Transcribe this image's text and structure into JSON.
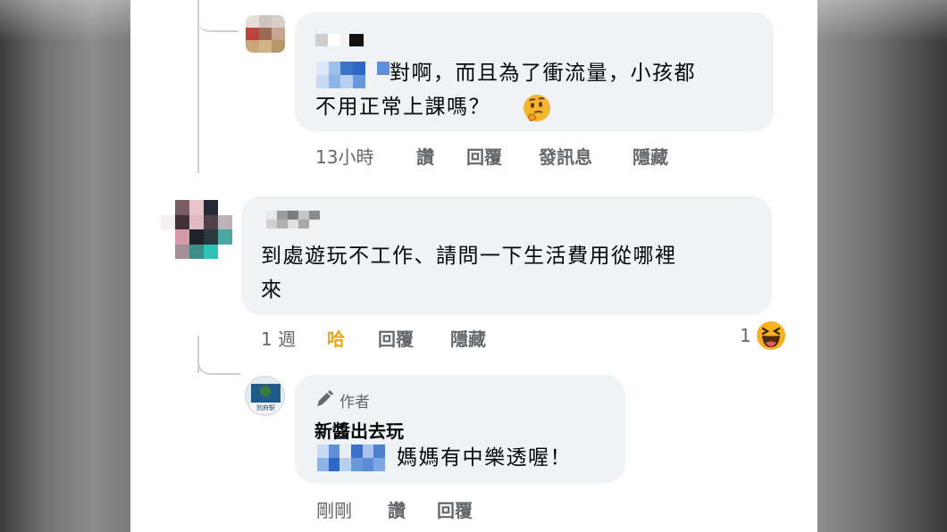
{
  "comments": [
    {
      "text_line1": "對啊，而且為了衝流量，小孩都",
      "text_line2": "不用正常上課嗎？",
      "time": "13小時",
      "like_label": "讚",
      "reply_label": "回覆",
      "message_label": "發訊息",
      "hide_label": "隱藏",
      "emoji": "thinking-face-emoji"
    },
    {
      "text_line1": "到處遊玩不工作、請問一下生活費用從哪裡",
      "text_line2": "來",
      "time": "1 週",
      "reaction_label": "哈",
      "reply_label": "回覆",
      "hide_label": "隱藏",
      "reaction_count": "1",
      "reaction_icon": "haha-reaction-icon"
    },
    {
      "author_badge": "作者",
      "author_name": "新醬出去玩",
      "text": "媽媽有中樂透喔！",
      "time": "剛剛",
      "like_label": "讚",
      "reply_label": "回覆",
      "avatar_text": "別府駅"
    }
  ],
  "colors": {
    "bubble": "#f0f2f5",
    "meta_text": "#65676b",
    "haha_active": "#e8a515",
    "thread_line": "#ced0d4"
  }
}
